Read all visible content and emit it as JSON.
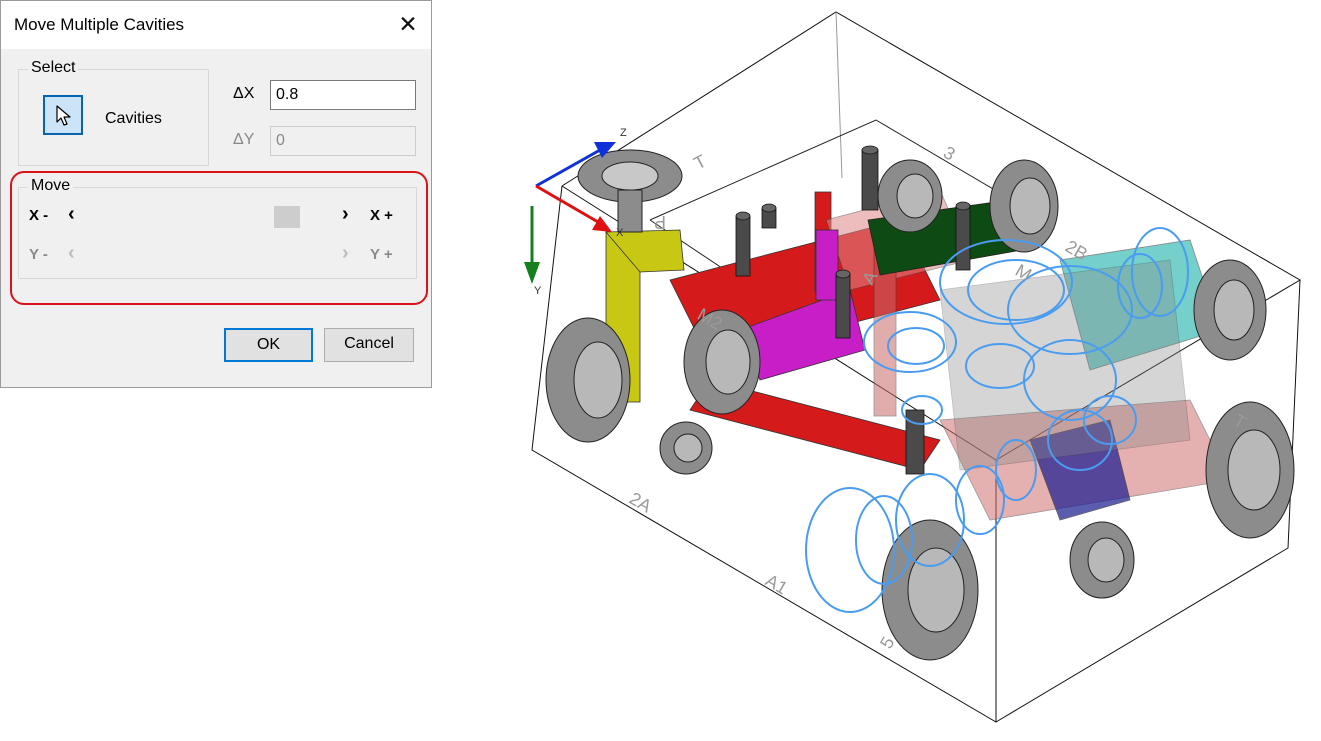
{
  "dialog": {
    "title": "Move Multiple Cavities",
    "close_glyph": "✕",
    "select": {
      "group_label": "Select",
      "pick_icon": "cursor-arrow-icon",
      "cavities_label": "Cavities",
      "dx_label": "ΔX",
      "dx_value": "0.8",
      "dy_label": "ΔY",
      "dy_value": "0"
    },
    "move": {
      "group_label": "Move",
      "x_minus": "X -",
      "x_plus": "X +",
      "y_minus": "Y -",
      "y_plus": "Y +",
      "left_arrow": "‹",
      "right_arrow": "›"
    },
    "ok_label": "OK",
    "cancel_label": "Cancel"
  },
  "viewport": {
    "axes": {
      "x": "X",
      "y": "Y",
      "z": "Z"
    },
    "port_labels": [
      "T",
      "3",
      "2B",
      "M2",
      "A",
      "P",
      "M",
      "2A",
      "A1",
      "5",
      "T"
    ],
    "colors": {
      "highlight": "#d8141b",
      "accent_blue": "#0078d7",
      "axis_x": "#e01010",
      "axis_y": "#14801c",
      "axis_z": "#1030d8",
      "selected_cavity": "#4a9cf0"
    }
  }
}
